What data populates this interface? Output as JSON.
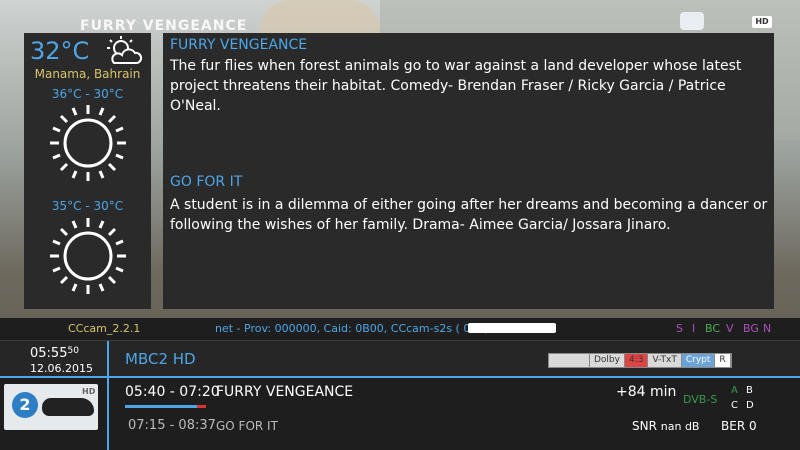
{
  "background": {
    "title_overlay": "FURRY VENGEANCE",
    "hd_badge": "HD"
  },
  "weather": {
    "current_temp": "32°C",
    "location": "Manama, Bahrain",
    "day1_range": "36°C - 30°C",
    "day2_range": "35°C - 30°C",
    "current_icon": "partly-cloudy-icon",
    "day1_icon": "sun-icon",
    "day2_icon": "sun-icon"
  },
  "epg": {
    "programs": [
      {
        "title": "FURRY VENGEANCE",
        "description": "The fur flies when forest animals go to war against a land developer whose latest project threatens their habitat. Comedy- Brendan Fraser / Ricky Garcia / Patrice O'Neal."
      },
      {
        "title": "GO FOR IT",
        "description": "A student is in a dilemma of either going after her dreams and becoming a dancer or following the wishes of her family. Drama- Aimee Garcia/ Jossara Jinaro."
      }
    ]
  },
  "infobar": {
    "cam": "CCcam_2.2.1",
    "net_info": "net - Prov: 000000, Caid: 0B00, CCcam-s2s (                           000) - 1128 ms",
    "flags": [
      "S",
      "I",
      "BC",
      "V",
      "BG",
      "N"
    ]
  },
  "channel": {
    "time": "05:55",
    "seconds": "50",
    "date": "12.06.2015",
    "name": "MBC2 HD",
    "badges": [
      "",
      "Dolby",
      "4:3",
      "V-TxT",
      "Crypt",
      "R"
    ]
  },
  "now_next": {
    "logo_number": "2",
    "logo_hd": "HD",
    "now_time": "05:40 - 07:20",
    "now_title": "FURRY VENGEANCE",
    "progress": 0.89,
    "next_time": "07:15 - 08:37",
    "next_title": "GO FOR IT",
    "remaining": "+84 min",
    "tuner_type": "DVB-S",
    "tuners": [
      "A",
      "B",
      "C",
      "D"
    ],
    "snr_label": "SNR",
    "snr_value": "nan dB",
    "ber_label": "BER",
    "ber_value": "0"
  },
  "colors": {
    "accent": "#4da6e8",
    "panel": "#2a2a2a",
    "location_yellow": "#d8c36b",
    "dvb_green": "#3a9a4a"
  }
}
